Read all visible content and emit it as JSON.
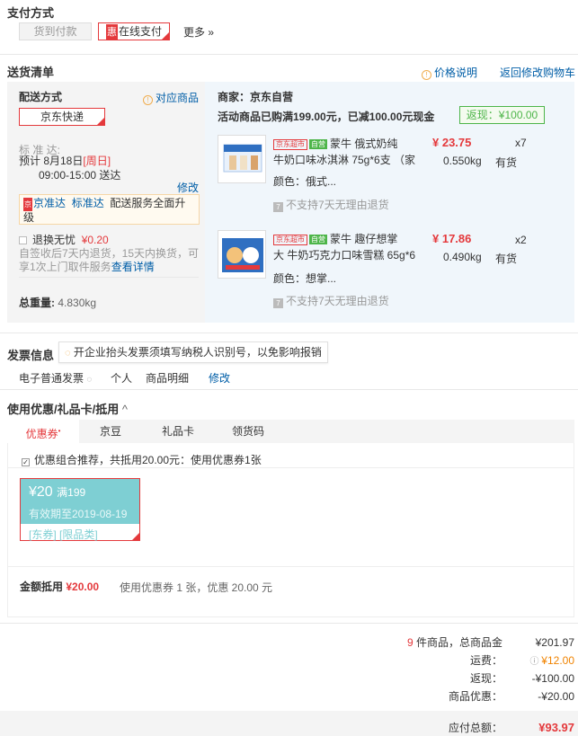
{
  "payment": {
    "title": "支付方式",
    "cod_label": "货到付款",
    "online_tag": "惠",
    "online_label": "在线支付",
    "more_label": "更多 »"
  },
  "delivery": {
    "title": "送货清单",
    "price_note": "价格说明",
    "back_cart": "返回修改购物车",
    "method_title": "配送方式",
    "corresponding_items": "对应商品",
    "shipper": "京东快递",
    "std_label": "标 准 达:",
    "eta_prefix": "预计 8月18日",
    "eta_day": "[周日]",
    "eta_time": "09:00-15:00 送达",
    "modify": "修改",
    "promo_jzd": "京准达",
    "promo_bzd": "标准达",
    "promo_text": "配送服务全面升级",
    "refund_label": "退换无忧",
    "refund_price": "¥0.20",
    "refund_desc": "自签收后7天内退货，15天内换货，可享1次上门取件服务",
    "refund_detail": "查看详情",
    "weight_label": "总重量:",
    "weight_value": "4.830kg"
  },
  "shop": {
    "name": "商家：京东自营",
    "promo": "活动商品已购满199.00元，已减100.00元现金",
    "rebate": "返现：¥100.00"
  },
  "products": [
    {
      "tag_jd": "京东超市",
      "tag_zy": "自营",
      "name_l1": "蒙牛 俄式奶纯",
      "name_l2": "牛奶口味冰淇淋 75g*6支 （家",
      "color_label": "颜色：",
      "color_value": "俄式...",
      "no_return": "不支持7天无理由退货",
      "price": "¥ 23.75",
      "qty": "x7",
      "weight": "0.550kg",
      "stock": "有货"
    },
    {
      "tag_jd": "京东超市",
      "tag_zy": "自营",
      "name_l1": "蒙牛 趣仔想掌",
      "name_l2": "大 牛奶巧克力口味雪糕 65g*6",
      "color_label": "颜色：",
      "color_value": "想掌...",
      "no_return": "不支持7天无理由退货",
      "price": "¥ 17.86",
      "qty": "x2",
      "weight": "0.490kg",
      "stock": "有货"
    }
  ],
  "invoice": {
    "title": "发票信息",
    "tip": "开企业抬头发票须填写纳税人识别号，以免影响报销",
    "type": "电子普通发票",
    "person": "个人",
    "detail": "商品明细",
    "modify": "修改"
  },
  "coupon": {
    "title": "使用优惠/礼品卡/抵用",
    "tabs": [
      "优惠券",
      "京豆",
      "礼品卡",
      "领货码"
    ],
    "combo_label": "优惠组合推荐，共抵用20.00元：使用优惠券1张",
    "card_amount": "¥20",
    "card_cond": "满199",
    "card_expire": "有效期至2019-08-19",
    "card_tag1": "[东券]",
    "card_tag2": "[限品类]",
    "amount_label": "金额抵用",
    "amount_value": "¥20.00",
    "amount_desc": "使用优惠券 1 张，优惠 20.00 元"
  },
  "summary": {
    "count": "9",
    "count_suffix": " 件商品，总商品金",
    "goods_total": "¥201.97",
    "freight_label": "运费：",
    "freight_value": "¥12.00",
    "rebate_label": "返现：",
    "rebate_value": "-¥100.00",
    "discount_label": "商品优惠：",
    "discount_value": "-¥20.00",
    "payable_label": "应付总额：",
    "payable_value": "¥93.97"
  },
  "colors": {
    "accent": "#e4393c",
    "link": "#005ea7",
    "delivery_bg": "#f4f4f4",
    "shop_bg": "#f0f6fb",
    "coupon_card": "#7ecfd3"
  }
}
